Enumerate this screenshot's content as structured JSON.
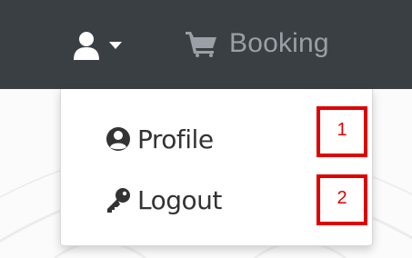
{
  "navbar": {
    "user_icon": "user-icon",
    "caret_icon": "caret-down-icon",
    "booking": {
      "icon": "shopping-cart-icon",
      "label": "Booking"
    }
  },
  "dropdown": {
    "items": [
      {
        "icon": "user-circle-icon",
        "label": "Profile"
      },
      {
        "icon": "key-icon",
        "label": "Logout"
      }
    ]
  },
  "annotations": [
    {
      "label": "1"
    },
    {
      "label": "2"
    }
  ],
  "colors": {
    "navbar_bg": "#3a3f44",
    "navbar_icon": "#ffffff",
    "navbar_link_muted": "#9aa0a6",
    "menu_text": "#333333",
    "annotation_red": "#e10000"
  }
}
